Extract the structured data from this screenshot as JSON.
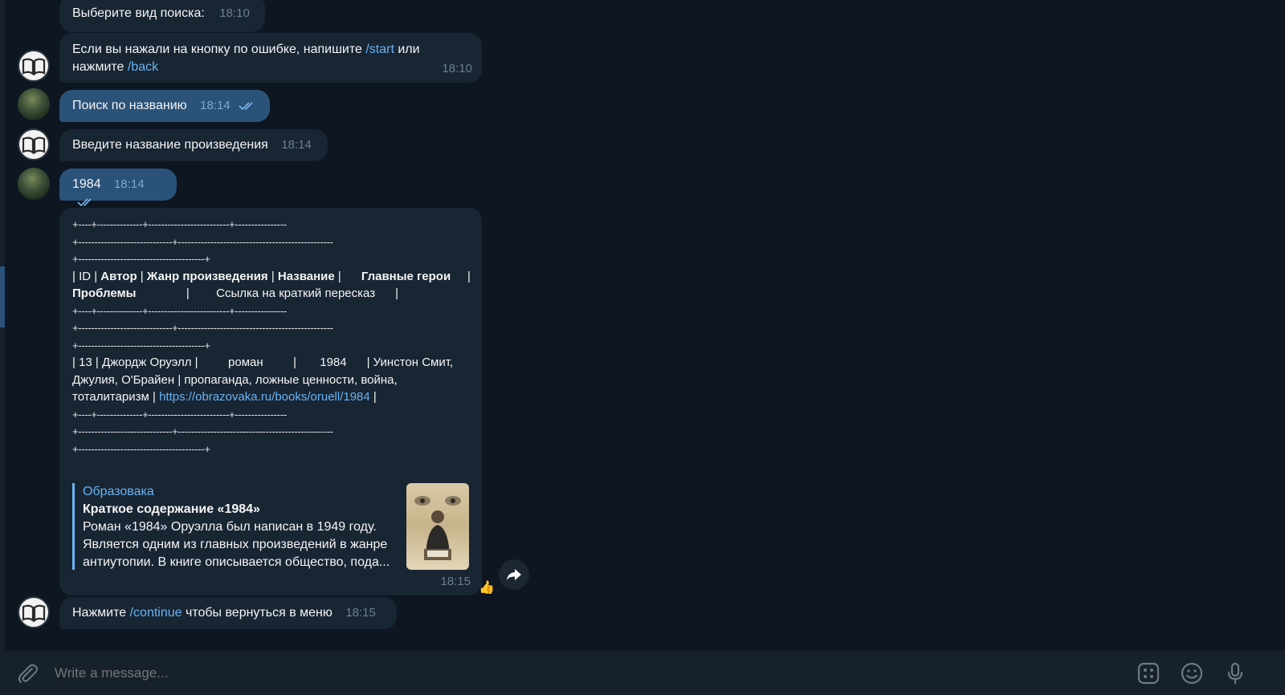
{
  "messages": {
    "m1": {
      "text": "Выберите вид поиска:",
      "time": "18:10"
    },
    "m2": {
      "text_before": "Если вы нажали на кнопку по ошибке, напишите ",
      "link1": "/start",
      "text_mid": " или",
      "text_line2": "нажмите ",
      "link2": "/back",
      "time": "18:10"
    },
    "m3": {
      "text": "Поиск по названию",
      "time": "18:14"
    },
    "m4": {
      "text": "Введите название произведения",
      "time": "18:14"
    },
    "m5": {
      "text": "1984",
      "time": "18:14"
    },
    "m6": {
      "rule_a": "+----+--------------+-------------------------+----------------",
      "rule_b": "+-----------------------------+------------------------------------------------",
      "rule_c": "+---------------------------------------+",
      "header_id": "| ID | ",
      "header_author": "Автор",
      "header_sep1": " | ",
      "header_genre": "Жанр произведения",
      "header_sep2": " | ",
      "header_title": "Название",
      "header_sep3": " |      ",
      "header_heroes": "Главные герои",
      "header_sep4": "     |               ",
      "header_problems": "Проблемы",
      "header_sep5": "               |        Ссылка на краткий пересказ      |",
      "row_text": "| 13 | Джордж Оруэлл |         роман         |       1984      | Уинстон Смит, Джулия, О'Брайен | пропаганда, ложные ценности, война, тоталитаризм | ",
      "row_link": "https://obrazovaka.ru/books/oruell/1984",
      "row_end": " |",
      "preview": {
        "site": "Образовака",
        "title": "Краткое содержание «1984»",
        "description": "Роман «1984» Оруэлла был написан в 1949 году. Является одним из главных произведений в жанре антиутопии. В книге описывается общество, пода..."
      },
      "time": "18:15",
      "reaction": "👍"
    },
    "m7": {
      "text_before": "Нажмите ",
      "link": "/continue",
      "text_after": " чтобы вернуться в меню",
      "time": "18:15"
    }
  },
  "composer": {
    "placeholder": "Write a message..."
  },
  "icons": {
    "attach": "paperclip-icon",
    "commands": "bot-commands-icon",
    "emoji": "emoji-icon",
    "mic": "microphone-icon",
    "share": "share-icon",
    "read": "double-check-icon"
  },
  "colors": {
    "background": "#0e1621",
    "incoming_bubble": "#182533",
    "outgoing_bubble": "#2b5278",
    "link": "#6ab3f3"
  }
}
